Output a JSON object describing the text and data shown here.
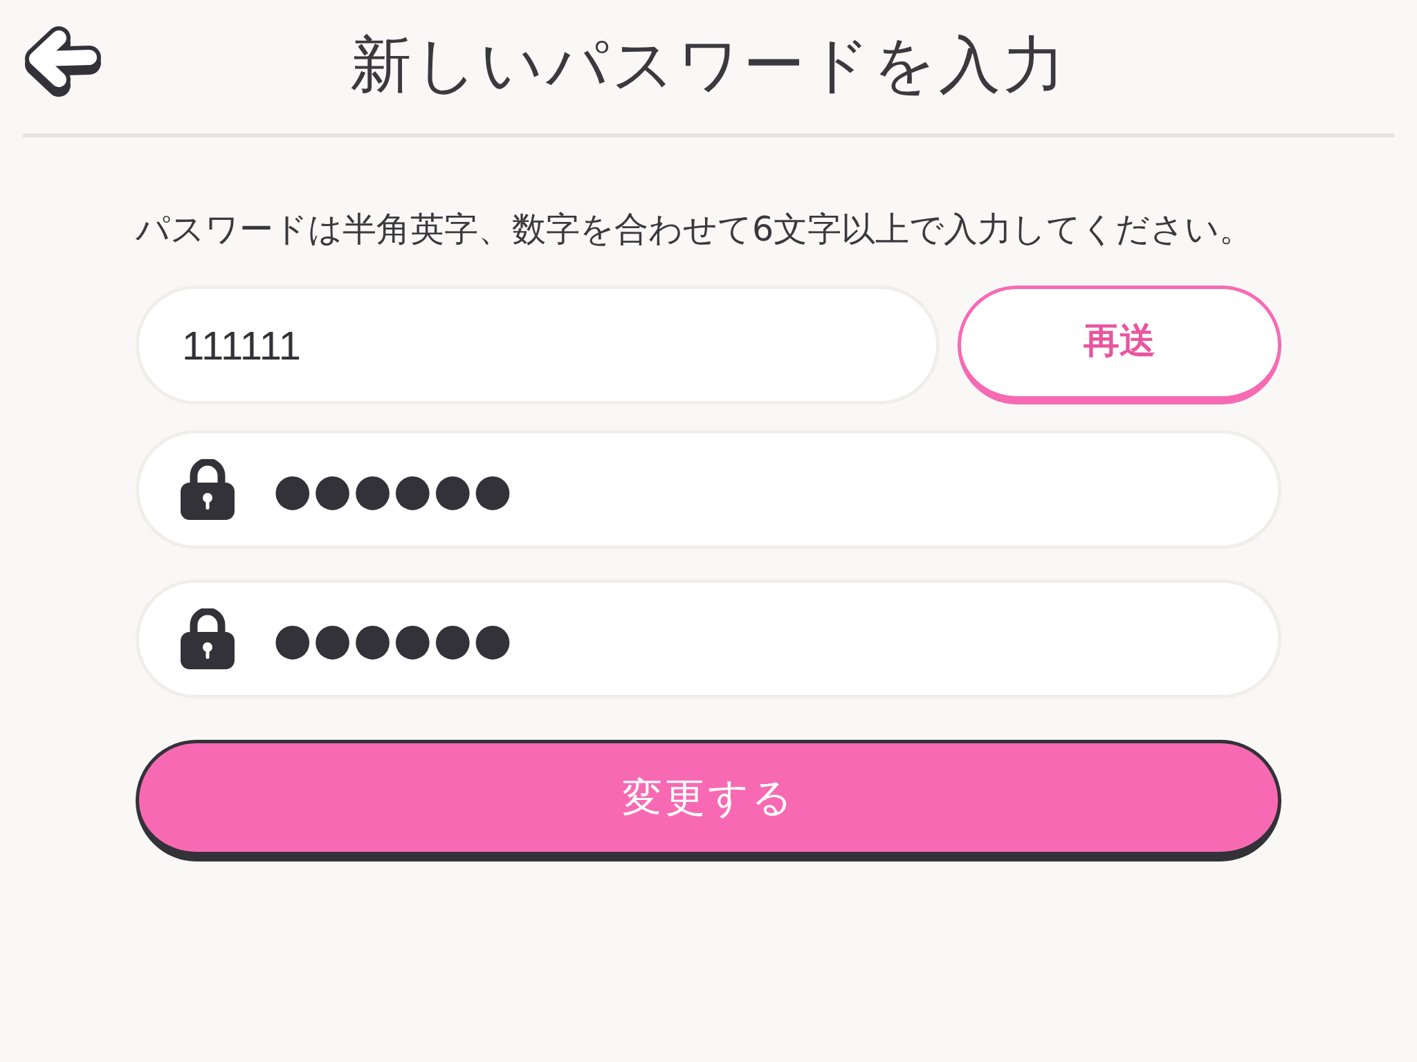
{
  "header": {
    "title": "新しいパスワードを入力"
  },
  "instruction": "パスワードは半角英字、数字を合わせて6文字以上で入力してください。",
  "code_row": {
    "field": {
      "value": "111111"
    },
    "button": {
      "label": "再送"
    }
  },
  "password_fields": [
    {
      "value": "●●●●●●"
    },
    {
      "value": "●●●●●●"
    }
  ],
  "submit_button": {
    "label": "変更する"
  }
}
